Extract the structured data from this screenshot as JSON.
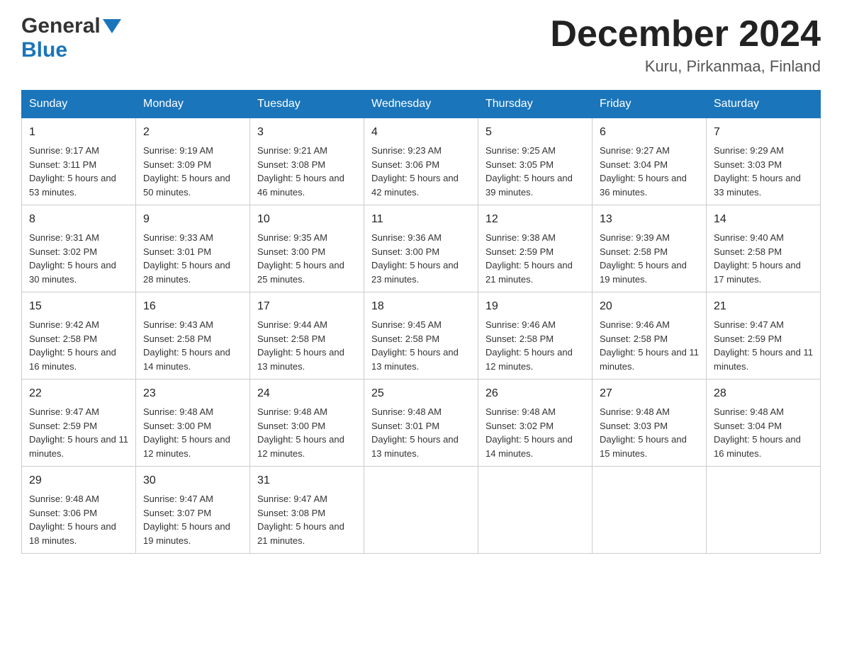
{
  "logo": {
    "general": "General",
    "blue": "Blue"
  },
  "title": "December 2024",
  "location": "Kuru, Pirkanmaa, Finland",
  "headers": [
    "Sunday",
    "Monday",
    "Tuesday",
    "Wednesday",
    "Thursday",
    "Friday",
    "Saturday"
  ],
  "weeks": [
    [
      {
        "day": "1",
        "sunrise": "9:17 AM",
        "sunset": "3:11 PM",
        "daylight": "5 hours and 53 minutes."
      },
      {
        "day": "2",
        "sunrise": "9:19 AM",
        "sunset": "3:09 PM",
        "daylight": "5 hours and 50 minutes."
      },
      {
        "day": "3",
        "sunrise": "9:21 AM",
        "sunset": "3:08 PM",
        "daylight": "5 hours and 46 minutes."
      },
      {
        "day": "4",
        "sunrise": "9:23 AM",
        "sunset": "3:06 PM",
        "daylight": "5 hours and 42 minutes."
      },
      {
        "day": "5",
        "sunrise": "9:25 AM",
        "sunset": "3:05 PM",
        "daylight": "5 hours and 39 minutes."
      },
      {
        "day": "6",
        "sunrise": "9:27 AM",
        "sunset": "3:04 PM",
        "daylight": "5 hours and 36 minutes."
      },
      {
        "day": "7",
        "sunrise": "9:29 AM",
        "sunset": "3:03 PM",
        "daylight": "5 hours and 33 minutes."
      }
    ],
    [
      {
        "day": "8",
        "sunrise": "9:31 AM",
        "sunset": "3:02 PM",
        "daylight": "5 hours and 30 minutes."
      },
      {
        "day": "9",
        "sunrise": "9:33 AM",
        "sunset": "3:01 PM",
        "daylight": "5 hours and 28 minutes."
      },
      {
        "day": "10",
        "sunrise": "9:35 AM",
        "sunset": "3:00 PM",
        "daylight": "5 hours and 25 minutes."
      },
      {
        "day": "11",
        "sunrise": "9:36 AM",
        "sunset": "3:00 PM",
        "daylight": "5 hours and 23 minutes."
      },
      {
        "day": "12",
        "sunrise": "9:38 AM",
        "sunset": "2:59 PM",
        "daylight": "5 hours and 21 minutes."
      },
      {
        "day": "13",
        "sunrise": "9:39 AM",
        "sunset": "2:58 PM",
        "daylight": "5 hours and 19 minutes."
      },
      {
        "day": "14",
        "sunrise": "9:40 AM",
        "sunset": "2:58 PM",
        "daylight": "5 hours and 17 minutes."
      }
    ],
    [
      {
        "day": "15",
        "sunrise": "9:42 AM",
        "sunset": "2:58 PM",
        "daylight": "5 hours and 16 minutes."
      },
      {
        "day": "16",
        "sunrise": "9:43 AM",
        "sunset": "2:58 PM",
        "daylight": "5 hours and 14 minutes."
      },
      {
        "day": "17",
        "sunrise": "9:44 AM",
        "sunset": "2:58 PM",
        "daylight": "5 hours and 13 minutes."
      },
      {
        "day": "18",
        "sunrise": "9:45 AM",
        "sunset": "2:58 PM",
        "daylight": "5 hours and 13 minutes."
      },
      {
        "day": "19",
        "sunrise": "9:46 AM",
        "sunset": "2:58 PM",
        "daylight": "5 hours and 12 minutes."
      },
      {
        "day": "20",
        "sunrise": "9:46 AM",
        "sunset": "2:58 PM",
        "daylight": "5 hours and 11 minutes."
      },
      {
        "day": "21",
        "sunrise": "9:47 AM",
        "sunset": "2:59 PM",
        "daylight": "5 hours and 11 minutes."
      }
    ],
    [
      {
        "day": "22",
        "sunrise": "9:47 AM",
        "sunset": "2:59 PM",
        "daylight": "5 hours and 11 minutes."
      },
      {
        "day": "23",
        "sunrise": "9:48 AM",
        "sunset": "3:00 PM",
        "daylight": "5 hours and 12 minutes."
      },
      {
        "day": "24",
        "sunrise": "9:48 AM",
        "sunset": "3:00 PM",
        "daylight": "5 hours and 12 minutes."
      },
      {
        "day": "25",
        "sunrise": "9:48 AM",
        "sunset": "3:01 PM",
        "daylight": "5 hours and 13 minutes."
      },
      {
        "day": "26",
        "sunrise": "9:48 AM",
        "sunset": "3:02 PM",
        "daylight": "5 hours and 14 minutes."
      },
      {
        "day": "27",
        "sunrise": "9:48 AM",
        "sunset": "3:03 PM",
        "daylight": "5 hours and 15 minutes."
      },
      {
        "day": "28",
        "sunrise": "9:48 AM",
        "sunset": "3:04 PM",
        "daylight": "5 hours and 16 minutes."
      }
    ],
    [
      {
        "day": "29",
        "sunrise": "9:48 AM",
        "sunset": "3:06 PM",
        "daylight": "5 hours and 18 minutes."
      },
      {
        "day": "30",
        "sunrise": "9:47 AM",
        "sunset": "3:07 PM",
        "daylight": "5 hours and 19 minutes."
      },
      {
        "day": "31",
        "sunrise": "9:47 AM",
        "sunset": "3:08 PM",
        "daylight": "5 hours and 21 minutes."
      },
      null,
      null,
      null,
      null
    ]
  ]
}
